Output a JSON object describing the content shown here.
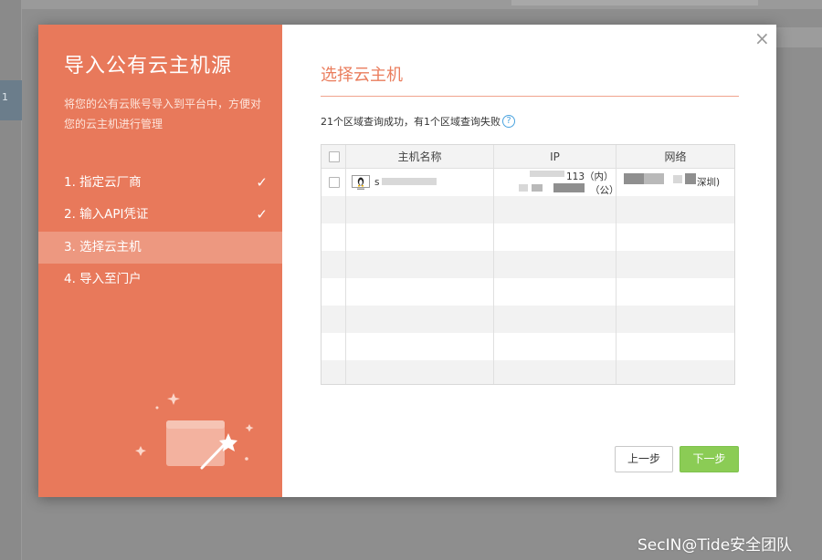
{
  "background": {
    "row_marker": "1"
  },
  "modal": {
    "close_glyph": "×",
    "sidebar": {
      "title": "导入公有云主机源",
      "description": "将您的公有云账号导入到平台中，方便对您的云主机进行管理",
      "steps": [
        {
          "label": "1. 指定云厂商",
          "done": true
        },
        {
          "label": "2. 输入API凭证",
          "done": true
        },
        {
          "label": "3. 选择云主机",
          "done": false,
          "active": true
        },
        {
          "label": "4. 导入至门户",
          "done": false
        }
      ],
      "check_glyph": "✓"
    },
    "content": {
      "title": "选择云主机",
      "status_text": "21个区域查询成功，有1个区域查询失败",
      "help_glyph": "?",
      "table": {
        "columns": [
          "主机名称",
          "IP",
          "网络"
        ],
        "rows": [
          {
            "host_partial": "s",
            "ip_inner_partial": "113（内）",
            "ip_public_partial": "（公）",
            "network_partial": "深圳)"
          }
        ]
      },
      "buttons": {
        "prev": "上一步",
        "next": "下一步"
      }
    }
  },
  "watermark": "SecIN@Tide安全团队",
  "colors": {
    "accent": "#e8795b",
    "accent_active": "#ed9880",
    "title": "#ea7d5d",
    "next_button": "#8bcc55",
    "help_icon": "#4aa3df"
  }
}
